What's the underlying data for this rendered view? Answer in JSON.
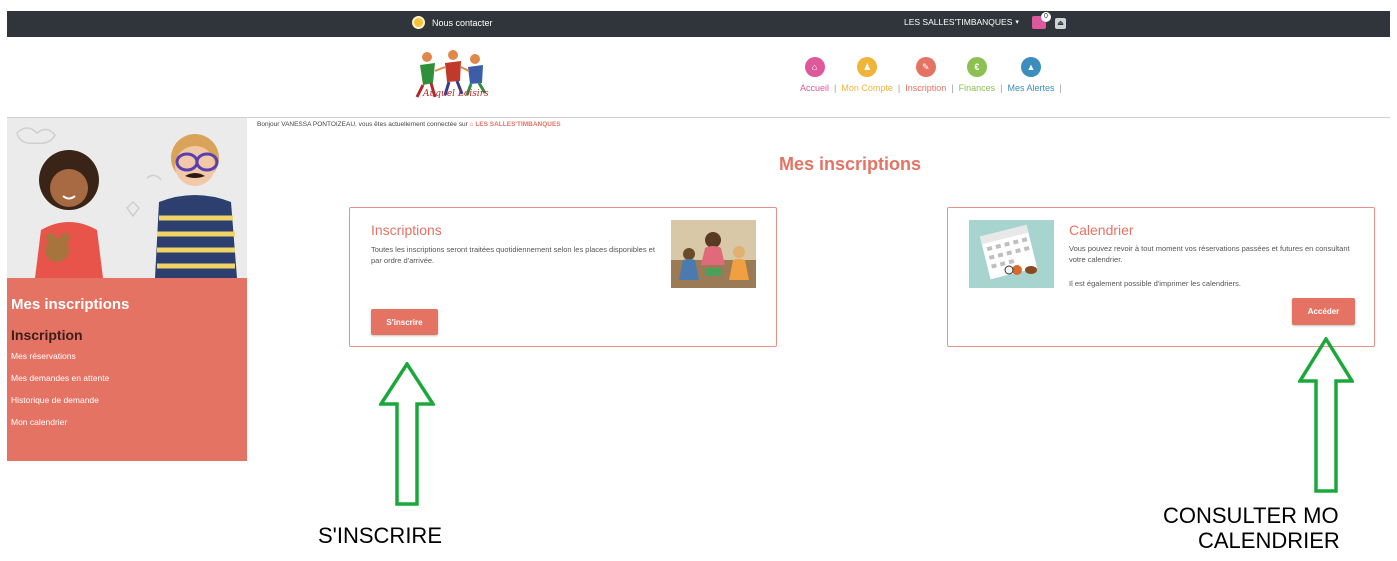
{
  "topbar": {
    "contact_label": "Nous contacter",
    "account_label": "LES SALLES'TIMBANQUES",
    "caret": "▾",
    "cart_count": "0",
    "logout_icon": "⏏"
  },
  "logo": {
    "text": "Auquel Loisirs"
  },
  "nav": {
    "items": [
      {
        "label": "Accueil",
        "color": "#e0589c",
        "icon": "⌂",
        "label_color": "#e0589c"
      },
      {
        "label": "Mon Compte",
        "color": "#f0b43a",
        "icon": "♟",
        "label_color": "#f0b43a"
      },
      {
        "label": "Inscription",
        "color": "#e57364",
        "icon": "✎",
        "label_color": "#e57364"
      },
      {
        "label": "Finances",
        "color": "#8cc152",
        "icon": "€",
        "label_color": "#8cc152"
      },
      {
        "label": "Mes Alertes",
        "color": "#3b8dbd",
        "icon": "▲",
        "label_color": "#3b8dbd"
      }
    ],
    "separator": "|"
  },
  "greeting": {
    "text": "Bonjour VANESSA PONTOIZEAU, vous êtes actuellement connectée sur",
    "venue_icon": "⌂",
    "venue": "LES SALLES'TIMBANQUES"
  },
  "sidebar": {
    "title": "Mes inscriptions",
    "subtitle": "Inscription",
    "links": [
      "Mes réservations",
      "Mes demandes en attente",
      "Historique de demande",
      "Mon calendrier"
    ]
  },
  "page_title": "Mes inscriptions",
  "cards": {
    "inscriptions": {
      "title": "Inscriptions",
      "text": "Toutes les inscriptions seront traitées quotidiennement selon les places disponibles et par ordre d'arrivée.",
      "button": "S'inscrire"
    },
    "calendrier": {
      "title": "Calendrier",
      "text1": "Vous pouvez revoir à tout moment vos réservations passées et futures en consultant votre calendrier.",
      "text2": "Il est également possible d'imprimer les calendriers.",
      "button": "Accéder"
    }
  },
  "annotations": {
    "left": "S'INSCRIRE",
    "right_line1": "CONSULTER MO",
    "right_line2": "CALENDRIER",
    "arrow_color": "#1aa83a"
  }
}
